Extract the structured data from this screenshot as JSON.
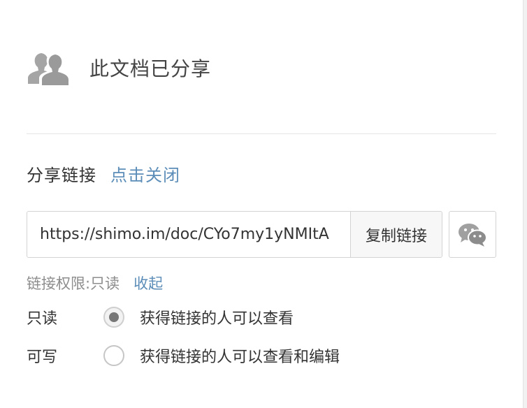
{
  "header": {
    "icon": "users-icon",
    "title": "此文档已分享"
  },
  "share": {
    "label": "分享链接",
    "close_link": "点击关闭",
    "link_value": "https://shimo.im/doc/CYo7my1yNMItA",
    "copy_label": "复制链接",
    "wechat_icon": "wechat-icon"
  },
  "permission": {
    "label": "链接权限:只读",
    "collapse_link": "收起",
    "options": [
      {
        "name": "只读",
        "description": "获得链接的人可以查看",
        "selected": true
      },
      {
        "name": "可写",
        "description": "获得链接的人可以查看和编辑",
        "selected": false
      }
    ]
  },
  "colors": {
    "link": "#5b8db8",
    "icon_gray": "#9a9a9a",
    "border": "#d3d3d3"
  }
}
